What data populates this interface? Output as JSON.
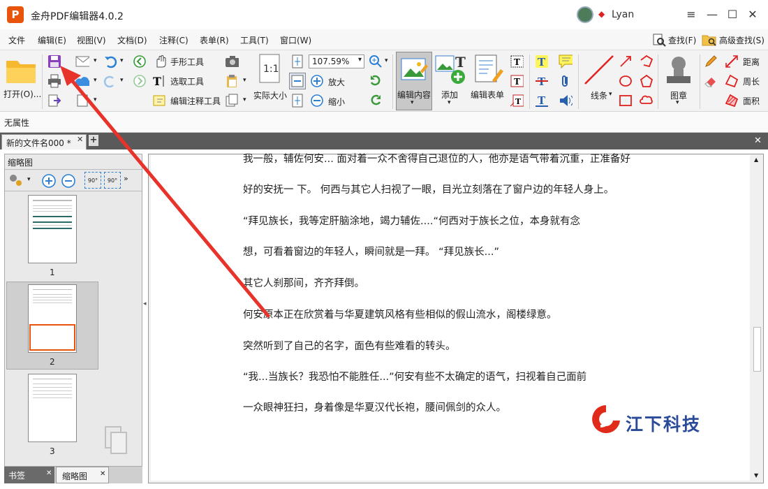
{
  "window": {
    "title": "金舟PDF编辑器4.0.2",
    "logo_letter": "P",
    "user": "Lyan"
  },
  "menu": [
    "文件",
    "编辑(E)",
    "视图(V)",
    "文档(D)",
    "注释(C)",
    "表单(R)",
    "工具(T)",
    "窗口(W)"
  ],
  "find": {
    "find_label": "查找(F)",
    "advanced_find_label": "高级查找(S)"
  },
  "toolbar": {
    "open": "打开(O)...",
    "hand_tool": "手形工具",
    "select_text": "选取工具",
    "edit_annotation": "编辑注释工具",
    "actual_size": "实际大小",
    "zoom_value": "107.59%",
    "zoom_in": "放大",
    "zoom_out": "缩小",
    "edit_content": "编辑内容",
    "add": "添加",
    "edit_form": "编辑表单",
    "line_label": "线条",
    "stamp_label": "图章",
    "distance": "距离",
    "perimeter": "周长",
    "area": "面积"
  },
  "properties": {
    "label": "无属性"
  },
  "tabs": {
    "doc_tab": "新的文件名000 *"
  },
  "side": {
    "title": "缩略图",
    "rotate_left": "90°",
    "rotate_right": "90°",
    "pages": [
      "1",
      "2",
      "3"
    ],
    "bottom_tabs": [
      "书签",
      "缩略图"
    ]
  },
  "doc": {
    "lines": [
      "我一般，辅佐何安...  面对着一众不舍得自己退位的人，他亦是语气带着沉重，正准备好",
      "好的安抚一  下。          何西与其它人扫视了一眼，目光立刻落在了窗户边的年轻人身上。",
      "“拜见族长，我等定肝脑涂地，竭力辅佐....“何西对于族长之位，本身就有念",
      "想，可看着窗边的年轻人，瞬间就是一拜。                               “拜见族长...”",
      "其它人刹那间，齐齐拜倒。",
      "何安原本正在欣赏着与华夏建筑风格有些相似的假山流水，阁楼绿意。",
      "突然听到了自己的名字，面色有些难看的转头。",
      "“我...当族长？我恐怕不能胜任...”何安有些不太确定的语气，扫视着自己面前",
      "一众眼神狂扫，身着像是华夏汉代长袍，腰间佩剑的众人。"
    ]
  },
  "watermark": {
    "text": "江下科技"
  },
  "colors": {
    "accent": "#e8540b",
    "arrow": "#e8332a",
    "tabstrip": "#5a5a5a"
  }
}
